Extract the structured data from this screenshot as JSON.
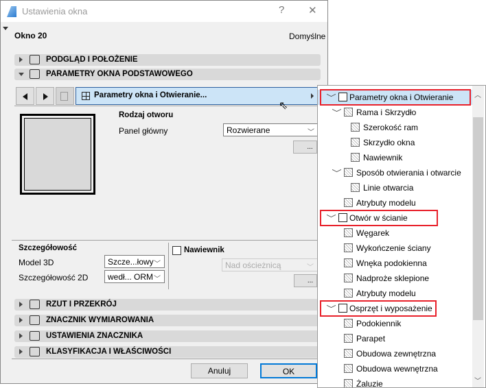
{
  "window": {
    "title": "Ustawienia okna",
    "help": "?",
    "close": "✕"
  },
  "element_name": "Okno 20",
  "preset": "Domyślne",
  "sections_top": [
    {
      "label": "PODGLĄD I POŁOŻENIE",
      "expanded": false
    },
    {
      "label": "PARAMETRY OKNA PODSTAWOWEGO",
      "expanded": true
    }
  ],
  "nav": {
    "page_label": "Parametry okna i Otwieranie..."
  },
  "opening": {
    "heading": "Rodzaj otworu",
    "panel_label": "Panel główny",
    "panel_value": "Rozwierane",
    "button": "..."
  },
  "detail": {
    "heading": "Szczegółowość",
    "model3d_label": "Model 3D",
    "model3d_value": "Szcze...łowy",
    "detail2d_label": "Szczegółowość 2D",
    "detail2d_value": "wedł... ORM"
  },
  "vent": {
    "label": "Nawiewnik",
    "checked": false,
    "position_value": "Nad ościeżnicą",
    "button": "..."
  },
  "sections_bottom": [
    {
      "label": "RZUT I PRZEKRÓJ"
    },
    {
      "label": "ZNACZNIK WYMIAROWANIA"
    },
    {
      "label": "USTAWIENIA ZNACZNIKA"
    },
    {
      "label": "KLASYFIKACJA I WŁAŚCIWOŚCI"
    }
  ],
  "buttons": {
    "cancel": "Anuluj",
    "ok": "OK"
  },
  "tree": [
    {
      "label": "Parametry okna i Otwieranie",
      "level": 0,
      "expanded": true,
      "selected": true,
      "highlighted": true
    },
    {
      "label": "Rama i Skrzydło",
      "level": 1,
      "expanded": true
    },
    {
      "label": "Szerokość ram",
      "level": 2
    },
    {
      "label": "Skrzydło okna",
      "level": 2
    },
    {
      "label": "Nawiewnik",
      "level": 2
    },
    {
      "label": "Sposób otwierania i otwarcie",
      "level": 1,
      "expanded": true
    },
    {
      "label": "Linie otwarcia",
      "level": 2
    },
    {
      "label": "Atrybuty modelu",
      "level": 1
    },
    {
      "label": "Otwór w ścianie",
      "level": 0,
      "expanded": true,
      "highlighted": true
    },
    {
      "label": "Węgarek",
      "level": 1
    },
    {
      "label": "Wykończenie ściany",
      "level": 1
    },
    {
      "label": "Wnęka podokienna",
      "level": 1
    },
    {
      "label": "Nadproże sklepione",
      "level": 1
    },
    {
      "label": "Atrybuty modelu",
      "level": 1
    },
    {
      "label": "Osprzęt i wyposażenie",
      "level": 0,
      "expanded": true,
      "highlighted": true
    },
    {
      "label": "Podokiennik",
      "level": 1
    },
    {
      "label": "Parapet",
      "level": 1
    },
    {
      "label": "Obudowa zewnętrzna",
      "level": 1
    },
    {
      "label": "Obudowa wewnętrzna",
      "level": 1
    },
    {
      "label": "Żaluzie",
      "level": 1
    }
  ],
  "colors": {
    "accent": "#0078d7",
    "selection": "#cce4f7",
    "highlight_box": "#e8202a"
  }
}
